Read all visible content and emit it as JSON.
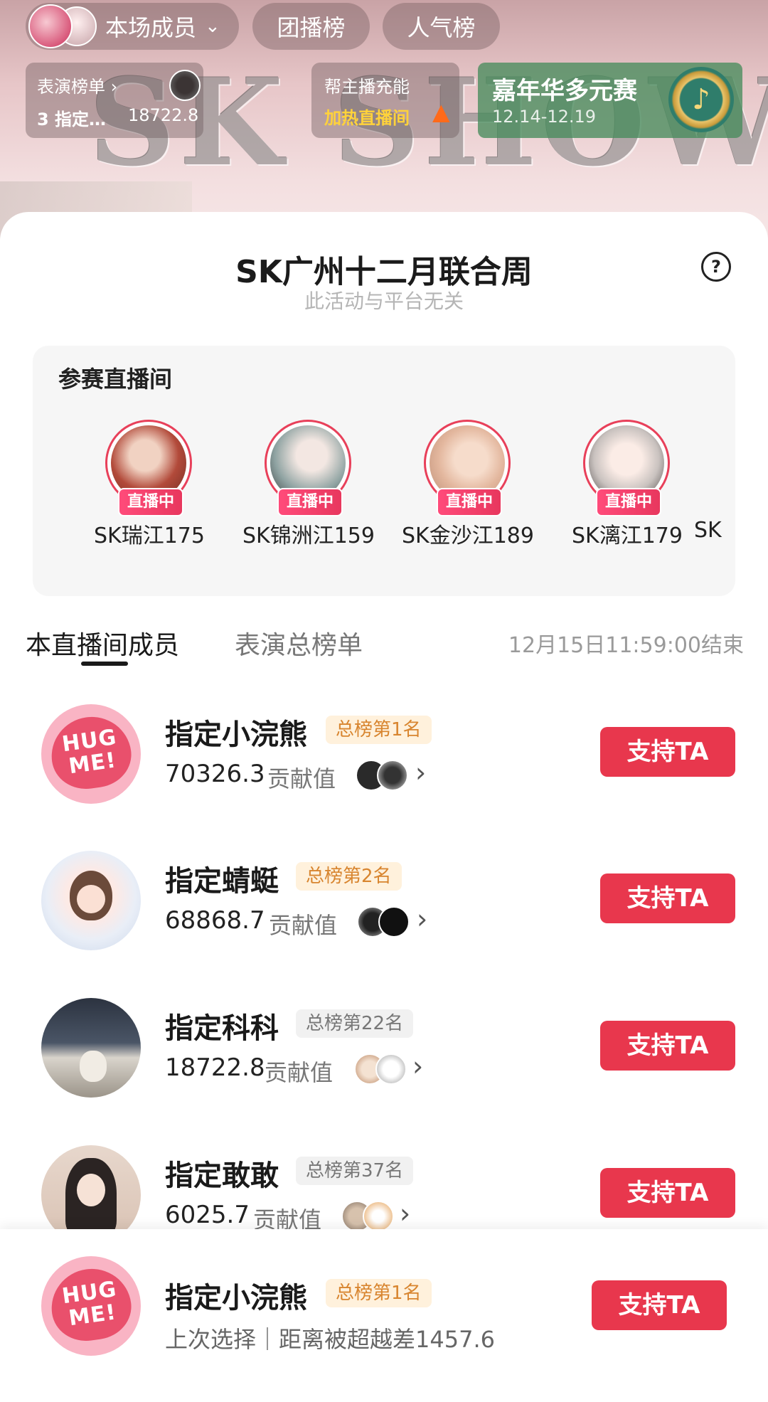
{
  "topbar": {
    "members_label": "本场成员",
    "team_label": "团播榜",
    "popularity_label": "人气榜",
    "perf_title": "表演榜单",
    "perf_rank": "3 指定…",
    "perf_score": "18722.8",
    "boost_line1": "帮主播充能",
    "boost_line2": "加热直播间",
    "carnival_title": "嘉年华多元赛",
    "carnival_dates": "12.14-12.19",
    "watermark": "SK SHOW"
  },
  "sheet": {
    "title": "SK广州十二月联合周",
    "subtitle": "此活动与平台无关",
    "help_icon": "?"
  },
  "rooms": {
    "header": "参赛直播间",
    "live_badge": "直播中",
    "items": [
      {
        "name": "SK瑞江175",
        "color": "#b24a3a"
      },
      {
        "name": "SK锦洲江159",
        "color": "#8fa3a2"
      },
      {
        "name": "SK金沙江189",
        "color": "#e3b79e"
      },
      {
        "name": "SK漓江179",
        "color": "#c9c2bf"
      },
      {
        "name": "SK",
        "color": "#dddddd"
      }
    ]
  },
  "tabs": {
    "active": "本直播间成员",
    "inactive": "表演总榜单",
    "end_time": "12月15日11:59:00结束"
  },
  "members": [
    {
      "name": "指定小浣熊",
      "rank": "总榜第1名",
      "score": "70326.3",
      "label": "贡献值",
      "button": "支持TA"
    },
    {
      "name": "指定蜻蜓",
      "rank": "总榜第2名",
      "score": "68868.7",
      "label": "贡献值",
      "button": "支持TA"
    },
    {
      "name": "指定科科",
      "rank": "总榜第22名",
      "score": "18722.8",
      "label": "贡献值",
      "button": "支持TA"
    },
    {
      "name": "指定敢敢",
      "rank": "总榜第37名",
      "score": "6025.7",
      "label": "贡献值",
      "button": "支持TA"
    }
  ],
  "bottom": {
    "name": "指定小浣熊",
    "rank": "总榜第1名",
    "sub": "上次选择｜距离被超越差1457.6",
    "button": "支持TA"
  },
  "avatar_text": "HUG ME!",
  "colors": {
    "accent": "#e8374d",
    "live_badge": "#ff4b7a",
    "rank_gold_bg": "#fff1dc",
    "rank_gold_text": "#d8852f"
  }
}
